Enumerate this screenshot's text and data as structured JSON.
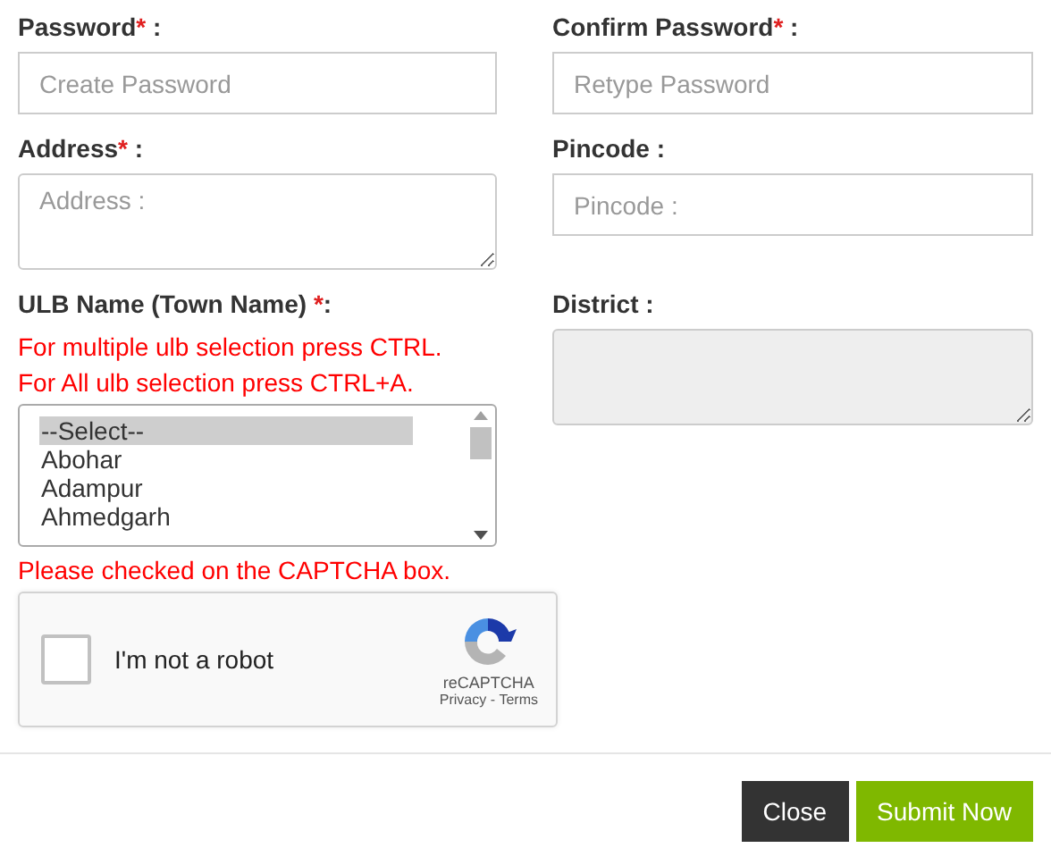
{
  "fields": [
    {
      "label": "Password",
      "required_mark": "*",
      "suffix": " :",
      "kind": "input",
      "placeholder": "Create Password"
    },
    {
      "label": "Confirm Password",
      "required_mark": "*",
      "suffix": " :",
      "kind": "input",
      "placeholder": "Retype Password"
    },
    {
      "label": "Address",
      "required_mark": "*",
      "suffix": " :",
      "kind": "textarea",
      "placeholder": "Address :"
    },
    {
      "label": "Pincode :",
      "kind": "input",
      "placeholder": "Pincode :"
    }
  ],
  "ulb": {
    "label": "ULB Name (Town Name) ",
    "required_mark": "*",
    "suffix": ":",
    "hints": [
      "For multiple ulb selection press CTRL.",
      "For All ulb selection press CTRL+A."
    ],
    "options": [
      {
        "text": "--Select--",
        "selected": true
      },
      {
        "text": "Abohar",
        "selected": false
      },
      {
        "text": "Adampur",
        "selected": false
      },
      {
        "text": "Ahmedgarh",
        "selected": false
      }
    ]
  },
  "district": {
    "label": "District :",
    "disabled": true
  },
  "captcha_error": "Please checked on the CAPTCHA box.",
  "captcha": {
    "checked": false,
    "label": "I'm not a robot",
    "brand": "reCAPTCHA",
    "privacy": "Privacy",
    "separator": " - ",
    "terms": "Terms"
  },
  "buttons": [
    {
      "label": "Close",
      "kind": "secondary"
    },
    {
      "label": "Submit Now",
      "kind": "primary"
    }
  ]
}
